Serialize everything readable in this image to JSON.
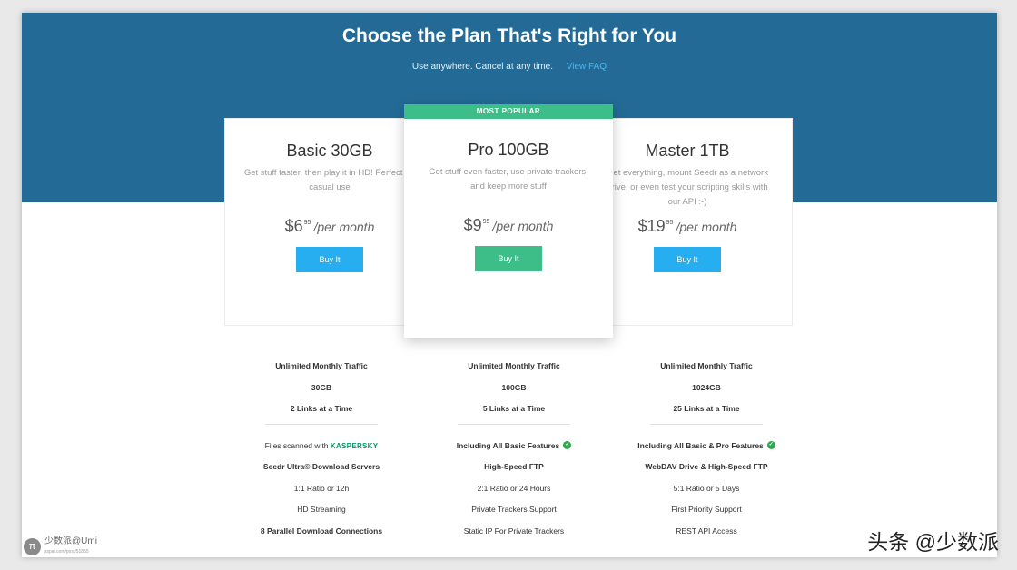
{
  "header": {
    "title": "Choose the Plan That's Right for You",
    "subtitle": "Use anywhere. Cancel at any time.",
    "faq_link": "View FAQ"
  },
  "colors": {
    "hero_bg": "#236b96",
    "buy_blue": "#27aef0",
    "buy_green": "#3dbd88",
    "popular_badge": "#3dbd88",
    "check_green": "#2fa84f"
  },
  "plans": [
    {
      "name": "Basic 30GB",
      "description": "Get stuff faster, then play it in HD! Perfect for casual use",
      "currency": "$",
      "price_whole": "6",
      "price_cents": "95",
      "period": "/per month",
      "buy_label": "Buy It",
      "features_top": [
        "Unlimited Monthly Traffic",
        "30GB",
        "2 Links at a Time"
      ],
      "scan_label": "Files scanned with",
      "scan_brand": "KASPERSKY",
      "features_bottom": [
        "Seedr Ultra© Download Servers",
        "1:1 Ratio or 12h",
        "HD Streaming",
        "8 Parallel Download Connections"
      ]
    },
    {
      "name": "Pro 100GB",
      "badge": "MOST POPULAR",
      "description": "Get stuff even faster, use private trackers, and keep more stuff",
      "currency": "$",
      "price_whole": "9",
      "price_cents": "95",
      "period": "/per month",
      "buy_label": "Buy It",
      "features_top": [
        "Unlimited Monthly Traffic",
        "100GB",
        "5 Links at a Time"
      ],
      "features_bottom": [
        "Including All Basic Features",
        "High-Speed FTP",
        "2:1 Ratio or 24 Hours",
        "Private Trackers Support",
        "Static IP For Private Trackers"
      ]
    },
    {
      "name": "Master 1TB",
      "description": "Get everything, mount Seedr as a network drive, or even test your scripting skills with our API :-)",
      "currency": "$",
      "price_whole": "19",
      "price_cents": "95",
      "period": "/per month",
      "buy_label": "Buy It",
      "features_top": [
        "Unlimited Monthly Traffic",
        "1024GB",
        "25 Links at a Time"
      ],
      "features_bottom": [
        "Including All Basic & Pro Features",
        "WebDAV Drive & High-Speed FTP",
        "5:1 Ratio or 5 Days",
        "First Priority Support",
        "REST API Access"
      ]
    }
  ],
  "icons": {
    "check": "check-circle-icon",
    "logo": "pi-logo-icon"
  },
  "watermark": {
    "left_pi": "π",
    "left_text": "少数派@Umi",
    "left_url": "sspai.com/post/51855",
    "right_text": "头条 @少数派"
  }
}
